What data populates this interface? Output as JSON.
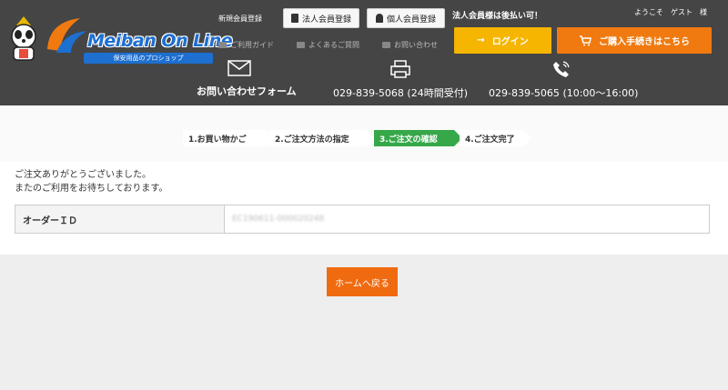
{
  "header": {
    "logo_text": "Meiban On Line",
    "logo_sub": "保安用品のプロショップ",
    "new_member": "新規会員登録",
    "corporate_register": "法人会員登録",
    "personal_register": "個人会員登録",
    "corporate_note": "法人会員様は後払い可！",
    "welcome": "ようこそ　ゲスト　様",
    "guide": "ご利用ガイド",
    "faq": "よくあるご質問",
    "inquiry": "お問い合わせ",
    "login": "ログイン",
    "checkout": "ご購入手続きはこちら",
    "contact_form": "お問い合わせフォーム",
    "fax": "029-839-5068",
    "fax_note": "(24時間受付)",
    "tel": "029-839-5065",
    "tel_note": "(10:00〜16:00)"
  },
  "steps": [
    {
      "label": "1.お買い物かご",
      "active": false
    },
    {
      "label": "2.ご注文方法の指定",
      "active": false
    },
    {
      "label": "3.ご注文の確認",
      "active": true
    },
    {
      "label": "4.ご注文完了",
      "active": false
    }
  ],
  "main": {
    "thanks_line1": "ご注文ありがとうございました。",
    "thanks_line2": "またのご利用をお待ちしております。",
    "order_id_label": "オーダーＩＤ",
    "order_id_value": "EC190611-000020248",
    "home_button": "ホームへ戻る"
  },
  "colors": {
    "header_bg": "#454545",
    "login": "#f5b500",
    "cart": "#f07a10",
    "active_step": "#37a84a",
    "home_button": "#f06a10"
  }
}
